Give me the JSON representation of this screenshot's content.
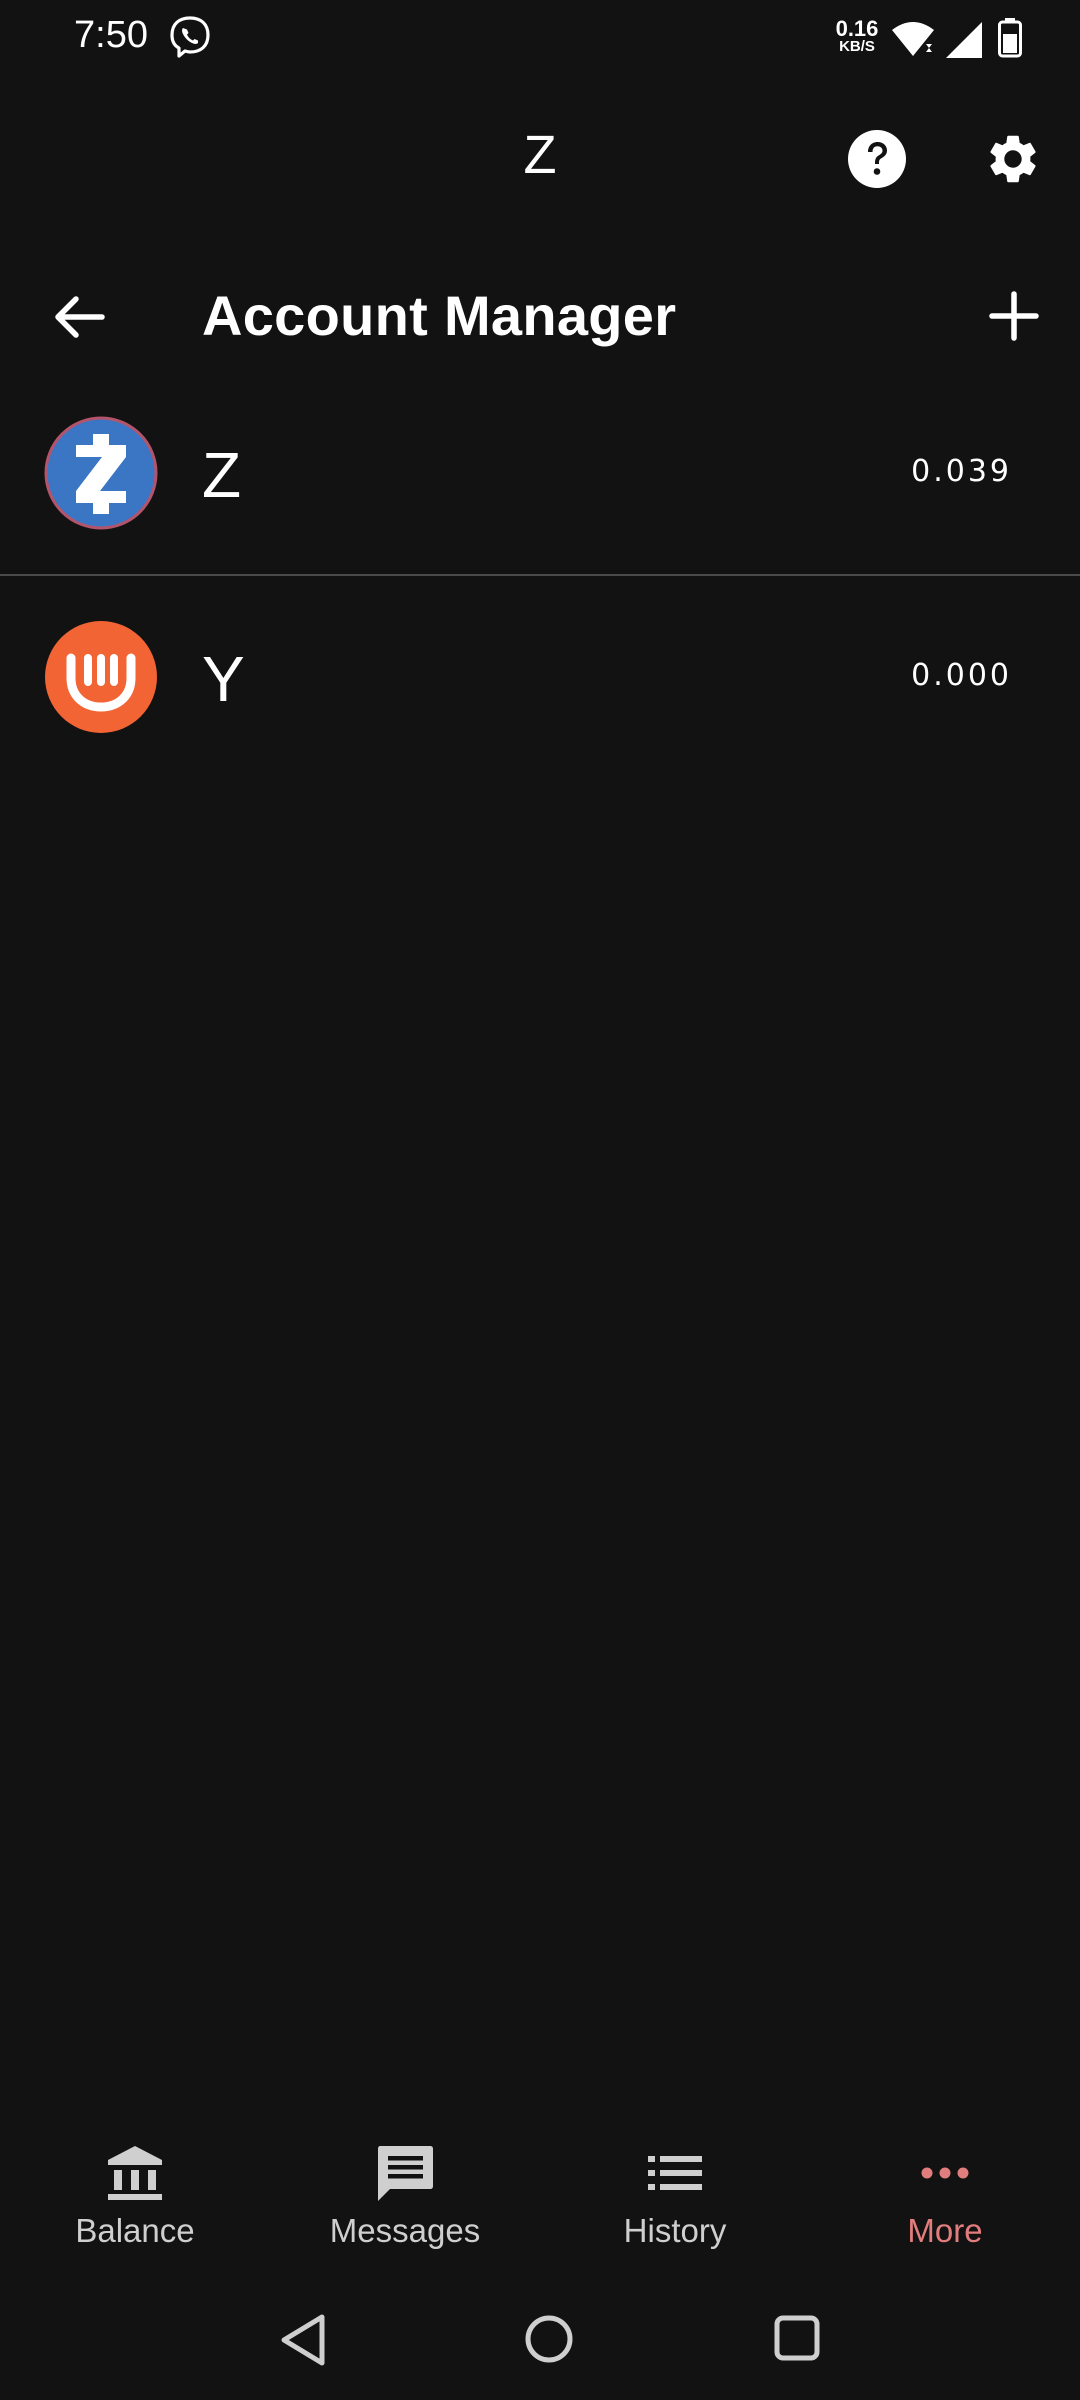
{
  "status_bar": {
    "time": "7:50",
    "net_speed_value": "0.16",
    "net_speed_unit": "KB/S",
    "icons": [
      "viber-icon",
      "wifi-icon",
      "signal-icon",
      "battery-icon"
    ]
  },
  "app_bar": {
    "title": "Z",
    "icons": [
      "help-icon",
      "settings-icon"
    ]
  },
  "page": {
    "title": "Account Manager",
    "back_icon": "back-arrow-icon",
    "add_icon": "plus-icon"
  },
  "accounts": [
    {
      "name": "Z",
      "balance": "0.039",
      "icon": "zcash-logo",
      "color": "#3A76C4"
    },
    {
      "name": "Y",
      "balance": "0.000",
      "icon": "ycash-logo",
      "color": "#F26433"
    }
  ],
  "bottom_nav": [
    {
      "label": "Balance",
      "icon": "bank-icon",
      "active": false
    },
    {
      "label": "Messages",
      "icon": "message-icon",
      "active": false
    },
    {
      "label": "History",
      "icon": "list-icon",
      "active": false
    },
    {
      "label": "More",
      "icon": "more-dots-icon",
      "active": true
    }
  ],
  "colors": {
    "background": "#121212",
    "accent": "#E27D7D",
    "text": "#FFFFFF"
  }
}
